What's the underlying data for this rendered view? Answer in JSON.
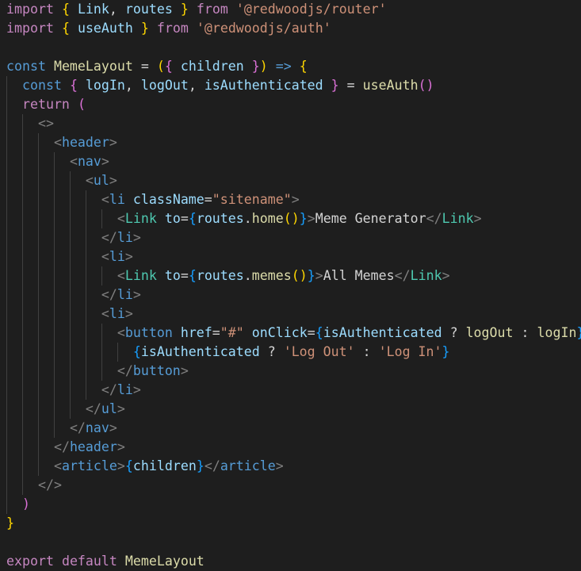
{
  "editor": {
    "lines": [
      [
        [
          "kw",
          "import"
        ],
        [
          "op",
          " "
        ],
        [
          "b1",
          "{"
        ],
        [
          "op",
          " "
        ],
        [
          "vr",
          "Link"
        ],
        [
          "op",
          ", "
        ],
        [
          "vr",
          "routes"
        ],
        [
          "op",
          " "
        ],
        [
          "b1",
          "}"
        ],
        [
          "op",
          " "
        ],
        [
          "kw",
          "from"
        ],
        [
          "op",
          " "
        ],
        [
          "str",
          "'@redwoodjs/router'"
        ]
      ],
      [
        [
          "kw",
          "import"
        ],
        [
          "op",
          " "
        ],
        [
          "b1",
          "{"
        ],
        [
          "op",
          " "
        ],
        [
          "vr",
          "useAuth"
        ],
        [
          "op",
          " "
        ],
        [
          "b1",
          "}"
        ],
        [
          "op",
          " "
        ],
        [
          "kw",
          "from"
        ],
        [
          "op",
          " "
        ],
        [
          "str",
          "'@redwoodjs/auth'"
        ]
      ],
      [],
      [
        [
          "st",
          "const"
        ],
        [
          "op",
          " "
        ],
        [
          "fn",
          "MemeLayout"
        ],
        [
          "op",
          " = "
        ],
        [
          "b1",
          "("
        ],
        [
          "b2",
          "{"
        ],
        [
          "op",
          " "
        ],
        [
          "vr",
          "children"
        ],
        [
          "op",
          " "
        ],
        [
          "b2",
          "}"
        ],
        [
          "b1",
          ")"
        ],
        [
          "op",
          " "
        ],
        [
          "st",
          "=>"
        ],
        [
          "op",
          " "
        ],
        [
          "b1",
          "{"
        ]
      ],
      [
        [
          "op",
          "  "
        ],
        [
          "st",
          "const"
        ],
        [
          "op",
          " "
        ],
        [
          "b2",
          "{"
        ],
        [
          "op",
          " "
        ],
        [
          "vr",
          "logIn"
        ],
        [
          "op",
          ", "
        ],
        [
          "vr",
          "logOut"
        ],
        [
          "op",
          ", "
        ],
        [
          "vr",
          "isAuthenticated"
        ],
        [
          "op",
          " "
        ],
        [
          "b2",
          "}"
        ],
        [
          "op",
          " = "
        ],
        [
          "fn",
          "useAuth"
        ],
        [
          "b2",
          "()"
        ]
      ],
      [
        [
          "op",
          "  "
        ],
        [
          "kw",
          "return"
        ],
        [
          "op",
          " "
        ],
        [
          "b2",
          "("
        ]
      ],
      [
        [
          "op",
          "    "
        ],
        [
          "brk",
          "<>"
        ]
      ],
      [
        [
          "op",
          "      "
        ],
        [
          "brk",
          "<"
        ],
        [
          "tag",
          "header"
        ],
        [
          "brk",
          ">"
        ]
      ],
      [
        [
          "op",
          "        "
        ],
        [
          "brk",
          "<"
        ],
        [
          "tag",
          "nav"
        ],
        [
          "brk",
          ">"
        ]
      ],
      [
        [
          "op",
          "          "
        ],
        [
          "brk",
          "<"
        ],
        [
          "tag",
          "ul"
        ],
        [
          "brk",
          ">"
        ]
      ],
      [
        [
          "op",
          "            "
        ],
        [
          "brk",
          "<"
        ],
        [
          "tag",
          "li"
        ],
        [
          "op",
          " "
        ],
        [
          "vr",
          "className"
        ],
        [
          "op",
          "="
        ],
        [
          "str",
          "\"sitename\""
        ],
        [
          "brk",
          ">"
        ]
      ],
      [
        [
          "op",
          "              "
        ],
        [
          "brk",
          "<"
        ],
        [
          "cmp",
          "Link"
        ],
        [
          "op",
          " "
        ],
        [
          "vr",
          "to"
        ],
        [
          "op",
          "="
        ],
        [
          "b3",
          "{"
        ],
        [
          "vr",
          "routes"
        ],
        [
          "op",
          "."
        ],
        [
          "fn",
          "home"
        ],
        [
          "b1",
          "()"
        ],
        [
          "b3",
          "}"
        ],
        [
          "brk",
          ">"
        ],
        [
          "tx",
          "Meme Generator"
        ],
        [
          "brk",
          "</"
        ],
        [
          "cmp",
          "Link"
        ],
        [
          "brk",
          ">"
        ]
      ],
      [
        [
          "op",
          "            "
        ],
        [
          "brk",
          "</"
        ],
        [
          "tag",
          "li"
        ],
        [
          "brk",
          ">"
        ]
      ],
      [
        [
          "op",
          "            "
        ],
        [
          "brk",
          "<"
        ],
        [
          "tag",
          "li"
        ],
        [
          "brk",
          ">"
        ]
      ],
      [
        [
          "op",
          "              "
        ],
        [
          "brk",
          "<"
        ],
        [
          "cmp",
          "Link"
        ],
        [
          "op",
          " "
        ],
        [
          "vr",
          "to"
        ],
        [
          "op",
          "="
        ],
        [
          "b3",
          "{"
        ],
        [
          "vr",
          "routes"
        ],
        [
          "op",
          "."
        ],
        [
          "fn",
          "memes"
        ],
        [
          "b1",
          "()"
        ],
        [
          "b3",
          "}"
        ],
        [
          "brk",
          ">"
        ],
        [
          "tx",
          "All Memes"
        ],
        [
          "brk",
          "</"
        ],
        [
          "cmp",
          "Link"
        ],
        [
          "brk",
          ">"
        ]
      ],
      [
        [
          "op",
          "            "
        ],
        [
          "brk",
          "</"
        ],
        [
          "tag",
          "li"
        ],
        [
          "brk",
          ">"
        ]
      ],
      [
        [
          "op",
          "            "
        ],
        [
          "brk",
          "<"
        ],
        [
          "tag",
          "li"
        ],
        [
          "brk",
          ">"
        ]
      ],
      [
        [
          "op",
          "              "
        ],
        [
          "brk",
          "<"
        ],
        [
          "tag",
          "button"
        ],
        [
          "op",
          " "
        ],
        [
          "vr",
          "href"
        ],
        [
          "op",
          "="
        ],
        [
          "str",
          "\"#\""
        ],
        [
          "op",
          " "
        ],
        [
          "vr",
          "onClick"
        ],
        [
          "op",
          "="
        ],
        [
          "b3",
          "{"
        ],
        [
          "vr",
          "isAuthenticated"
        ],
        [
          "op",
          " ? "
        ],
        [
          "fn",
          "logOut"
        ],
        [
          "op",
          " : "
        ],
        [
          "fn",
          "logIn"
        ],
        [
          "b3",
          "}"
        ],
        [
          "brk",
          ">"
        ]
      ],
      [
        [
          "op",
          "                "
        ],
        [
          "b3",
          "{"
        ],
        [
          "vr",
          "isAuthenticated"
        ],
        [
          "op",
          " ? "
        ],
        [
          "str",
          "'Log Out'"
        ],
        [
          "op",
          " : "
        ],
        [
          "str",
          "'Log In'"
        ],
        [
          "b3",
          "}"
        ]
      ],
      [
        [
          "op",
          "              "
        ],
        [
          "brk",
          "</"
        ],
        [
          "tag",
          "button"
        ],
        [
          "brk",
          ">"
        ]
      ],
      [
        [
          "op",
          "            "
        ],
        [
          "brk",
          "</"
        ],
        [
          "tag",
          "li"
        ],
        [
          "brk",
          ">"
        ]
      ],
      [
        [
          "op",
          "          "
        ],
        [
          "brk",
          "</"
        ],
        [
          "tag",
          "ul"
        ],
        [
          "brk",
          ">"
        ]
      ],
      [
        [
          "op",
          "        "
        ],
        [
          "brk",
          "</"
        ],
        [
          "tag",
          "nav"
        ],
        [
          "brk",
          ">"
        ]
      ],
      [
        [
          "op",
          "      "
        ],
        [
          "brk",
          "</"
        ],
        [
          "tag",
          "header"
        ],
        [
          "brk",
          ">"
        ]
      ],
      [
        [
          "op",
          "      "
        ],
        [
          "brk",
          "<"
        ],
        [
          "tag",
          "article"
        ],
        [
          "brk",
          ">"
        ],
        [
          "b3",
          "{"
        ],
        [
          "vr",
          "children"
        ],
        [
          "b3",
          "}"
        ],
        [
          "brk",
          "</"
        ],
        [
          "tag",
          "article"
        ],
        [
          "brk",
          ">"
        ]
      ],
      [
        [
          "op",
          "    "
        ],
        [
          "brk",
          "</>"
        ]
      ],
      [
        [
          "op",
          "  "
        ],
        [
          "b2",
          ")"
        ]
      ],
      [
        [
          "b1",
          "}"
        ]
      ],
      [],
      [
        [
          "kw",
          "export"
        ],
        [
          "op",
          " "
        ],
        [
          "kw",
          "default"
        ],
        [
          "op",
          " "
        ],
        [
          "fn",
          "MemeLayout"
        ]
      ]
    ]
  },
  "colors": {
    "background": "#1e1e1e",
    "keyword_control": "#c586c0",
    "keyword_storage": "#569cd6",
    "variable": "#9cdcfe",
    "function": "#dcdcaa",
    "string": "#ce9178",
    "component": "#4ec9b0",
    "punctuation": "#808080",
    "bracket_1": "#ffd700",
    "bracket_2": "#da70d6",
    "bracket_3": "#179fff"
  }
}
